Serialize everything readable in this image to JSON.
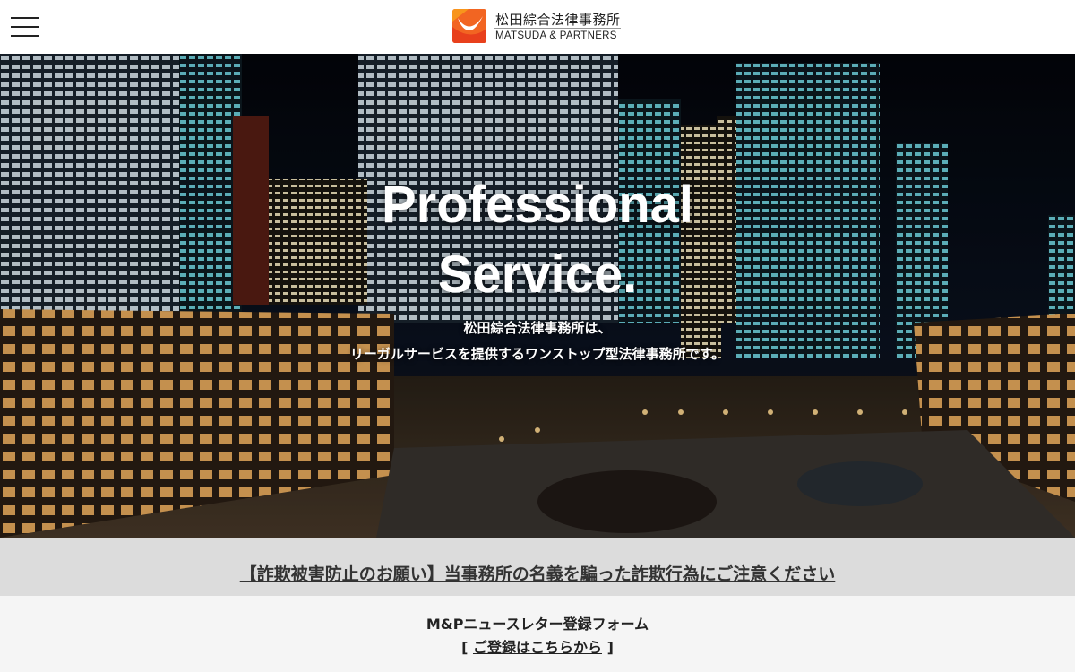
{
  "header": {
    "menu_icon": "hamburger-menu-icon",
    "logo": {
      "name_ja": "松田綜合法律事務所",
      "name_en": "MATSUDA & PARTNERS",
      "mark_colors": [
        "#f26522",
        "#e8401c",
        "#f9a11b"
      ]
    }
  },
  "hero": {
    "title_line1": "Professional",
    "title_line2": "Service.",
    "subtitle_line1": "松田綜合法律事務所は、",
    "subtitle_line2": "リーガルサービスを提供するワンストップ型法律事務所です。"
  },
  "notice": {
    "link_text": "【詐欺被害防止のお願い】当事務所の名義を騙った詐欺行為にご注意ください"
  },
  "newsletter": {
    "title": "M&Pニュースレター登録フォーム",
    "bracket_open": "[ ",
    "link_text": "ご登録はこちらから",
    "bracket_close": " ]"
  }
}
